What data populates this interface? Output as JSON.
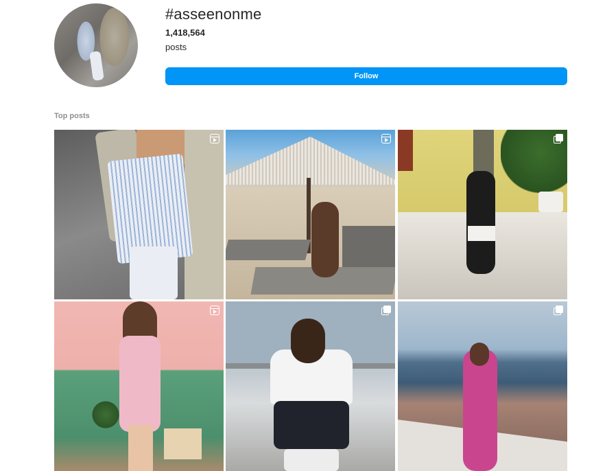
{
  "header": {
    "hashtag": "#asseenonme",
    "post_count": "1,418,564",
    "post_count_label": "posts",
    "follow_label": "Follow"
  },
  "sections": {
    "top_posts_title": "Top posts"
  },
  "posts": [
    {
      "type_icon": "reel-icon",
      "subject": "striped-skirt"
    },
    {
      "type_icon": "reel-icon",
      "subject": "beach-umbrella"
    },
    {
      "type_icon": "carousel-icon",
      "subject": "yellow-wall"
    },
    {
      "type_icon": "reel-icon",
      "subject": "pink-dress"
    },
    {
      "type_icon": "carousel-icon",
      "subject": "white-tee"
    },
    {
      "type_icon": "carousel-icon",
      "subject": "santorini"
    }
  ],
  "colors": {
    "follow_button": "#0095f6",
    "muted_text": "#8e8e8e",
    "primary_text": "#262626"
  }
}
